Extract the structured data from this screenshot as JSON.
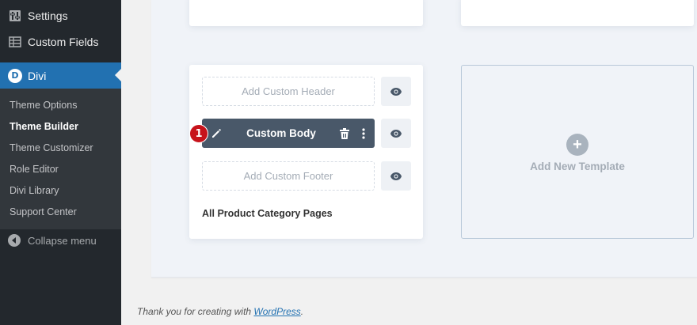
{
  "sidebar": {
    "settings_label": "Settings",
    "custom_fields_label": "Custom Fields",
    "divi_label": "Divi",
    "divi_logo_letter": "D",
    "submenu": [
      {
        "label": "Theme Options"
      },
      {
        "label": "Theme Builder",
        "active": true
      },
      {
        "label": "Theme Customizer"
      },
      {
        "label": "Role Editor"
      },
      {
        "label": "Divi Library"
      },
      {
        "label": "Support Center"
      }
    ],
    "collapse_label": "Collapse menu",
    "colors": {
      "bg": "#23282d",
      "active": "#2271b1",
      "submenu_bg": "#32373c"
    }
  },
  "template_card": {
    "header_placeholder": "Add Custom Header",
    "body_label": "Custom Body",
    "footer_placeholder": "Add Custom Footer",
    "title": "All Product Category Pages",
    "step_number": "1",
    "icons": [
      "pencil-icon",
      "trash-icon",
      "more-dots-icon",
      "eye-icon"
    ]
  },
  "add_new": {
    "plus": "+",
    "label": "Add New Template"
  },
  "footer": {
    "prefix": "Thank you for creating with ",
    "link_text": "WordPress",
    "suffix": "."
  }
}
